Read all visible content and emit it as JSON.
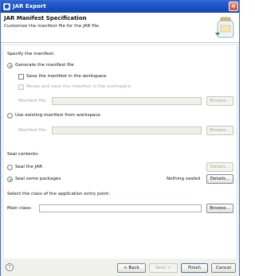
{
  "window": {
    "title": "JAR Export",
    "close_label": "×"
  },
  "header": {
    "title": "JAR Manifest Specification",
    "description": "Customize the manifest file for the JAR file."
  },
  "manifest": {
    "specify_label": "Specify the manifest:",
    "generate_label": "Generate the manifest file",
    "generate_selected": true,
    "save_label": "Save the manifest in the workspace",
    "save_checked": false,
    "reuse_label": "Reuse and save the manifest in the workspace",
    "reuse_checked": false,
    "manifest_file_label": "Manifest file:",
    "manifest_file_value": "",
    "browse_label": "Browse...",
    "use_existing_label": "Use existing manifest from workspace",
    "use_existing_selected": false,
    "existing_file_label": "Manifest file:",
    "existing_file_value": "",
    "existing_browse_label": "Browse..."
  },
  "seal": {
    "section_label": "Seal contents:",
    "seal_jar_label": "Seal the JAR",
    "seal_jar_selected": false,
    "seal_jar_details_label": "Details...",
    "seal_some_label": "Seal some packages",
    "seal_some_selected": true,
    "status_text": "Nothing sealed",
    "seal_some_details_label": "Details..."
  },
  "entry": {
    "section_label": "Select the class of the application entry point:",
    "main_class_label": "Main class:",
    "main_class_value": "",
    "browse_label": "Browse..."
  },
  "footer": {
    "help_icon": "?",
    "back_label": "< Back",
    "next_label": "Next >",
    "finish_label": "Finish",
    "cancel_label": "Cancel"
  },
  "colors": {
    "titlebar": "#1a4fc0",
    "dialog_bg": "#f1f1ec",
    "close_button": "#d44b2c"
  }
}
